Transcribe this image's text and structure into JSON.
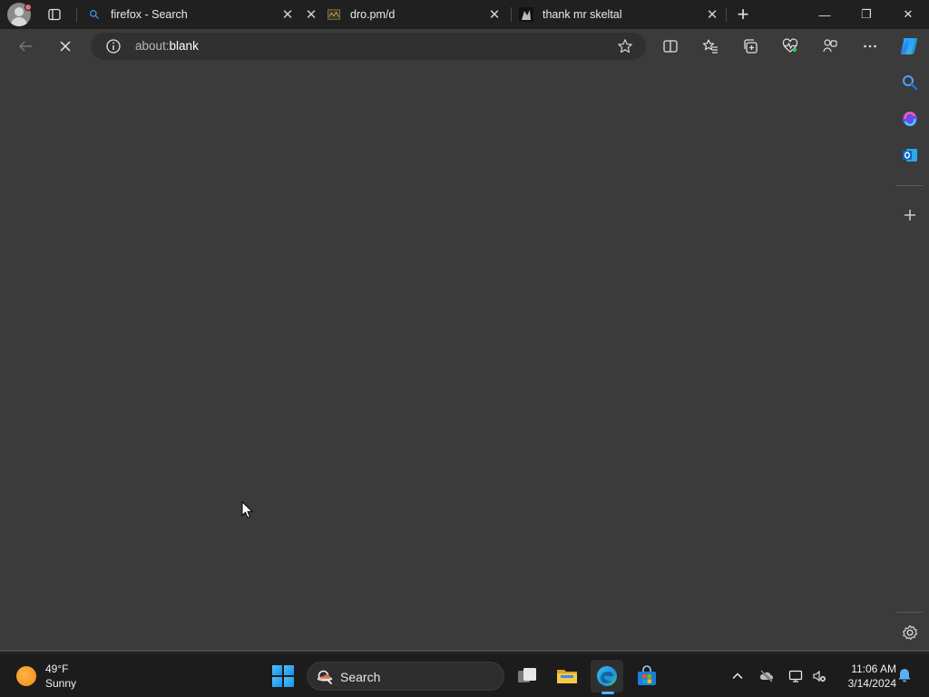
{
  "tabs": [
    {
      "title": "firefox - Search",
      "favicon": "search-icon"
    },
    {
      "title": "dro.pm/d",
      "favicon": "site-favicon"
    },
    {
      "title": "thank mr skeltal",
      "favicon": "site-favicon"
    }
  ],
  "tab_close_glyph": "✕",
  "new_tab_glyph": "+",
  "window_controls": {
    "minimize": "—",
    "restore": "❐",
    "close": "✕"
  },
  "address_bar": {
    "prefix": "about:",
    "value": "blank"
  },
  "toolbar_icons": [
    "back-icon",
    "stop-loading-icon",
    "info-icon",
    "favorite-star-icon",
    "split-screen-icon",
    "favorites-icon",
    "collections-icon",
    "browser-essentials-icon",
    "extensions-icon",
    "more-icon",
    "copilot-icon"
  ],
  "sidebar_icons": [
    "search-icon",
    "copilot-icon",
    "outlook-icon",
    "add-icon",
    "settings-icon"
  ],
  "taskbar": {
    "weather": {
      "temp": "49°F",
      "condition": "Sunny"
    },
    "search_label": "Search",
    "time": "11:06 AM",
    "date": "3/14/2024"
  },
  "colors": {
    "accent": "#1a8fe3",
    "content_bg": "#3b3b3b",
    "chrome_bg": "#202020"
  }
}
